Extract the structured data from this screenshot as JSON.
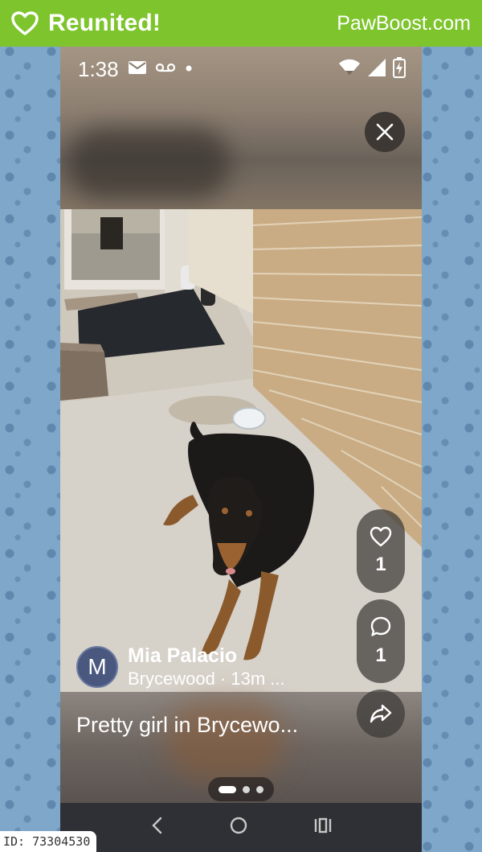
{
  "banner": {
    "icon": "heart-icon",
    "title": "Reunited!",
    "site": "PawBoost.com",
    "color": "#7dc42d"
  },
  "status_bar": {
    "time": "1:38",
    "icons": [
      "mail-icon",
      "voicemail-icon",
      "dot-icon",
      "wifi-icon",
      "signal-icon",
      "battery-charging-icon"
    ]
  },
  "post": {
    "user": {
      "initial": "M",
      "name": "Mia Palacio",
      "subtitle": "Brycewood · 13m ..."
    },
    "caption": "Pretty girl in Brycewo...",
    "likes": "1",
    "comments": "1",
    "page_indicator": {
      "count": 3,
      "active": 0
    }
  },
  "nav_bar": {
    "icons": [
      "back-icon",
      "home-icon",
      "recents-icon"
    ]
  },
  "id_tag": "ID: 73304530"
}
